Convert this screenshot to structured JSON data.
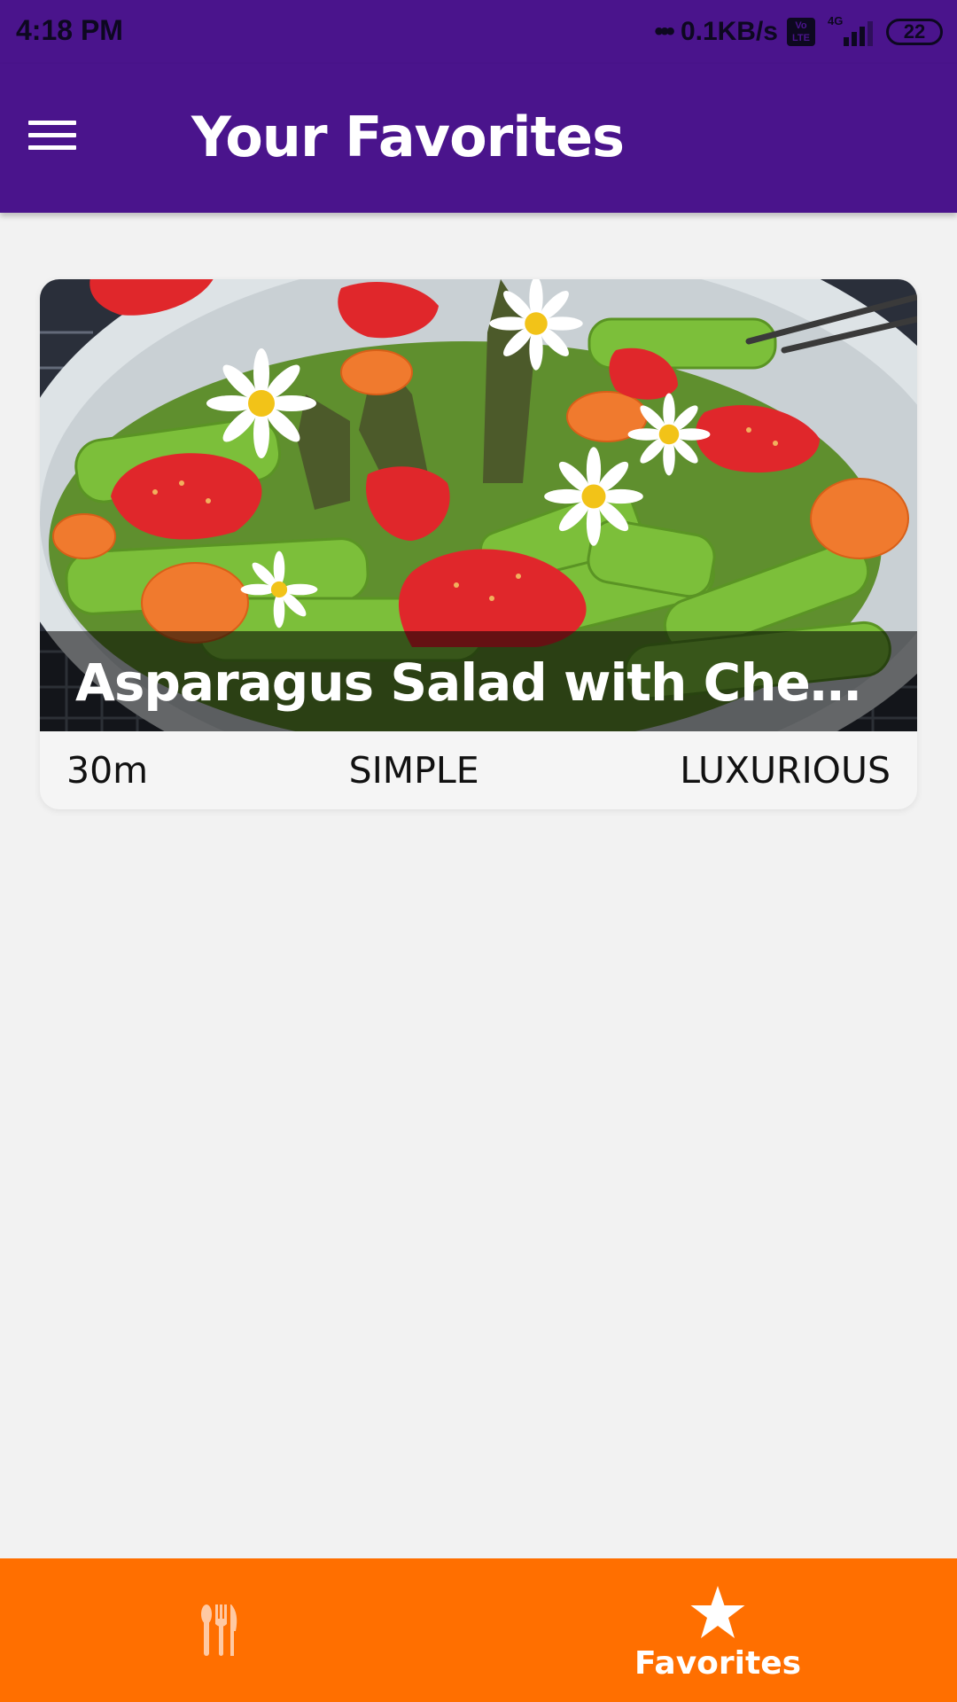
{
  "status_bar": {
    "time": "4:18 PM",
    "net_speed": "0.1KB/s",
    "volte": "Vo LTE",
    "network": "4G",
    "battery": "22"
  },
  "app_bar": {
    "title": "Your Favorites",
    "menu_icon": "hamburger-menu-icon"
  },
  "meal": {
    "title": "Asparagus Salad with Cherry Tomatoes",
    "duration": "30m",
    "complexity": "SIMPLE",
    "affordability": "LUXURIOUS"
  },
  "bottom_nav": {
    "tabs": [
      {
        "icon": "fork-knife-icon",
        "label": "",
        "active": false
      },
      {
        "icon": "star-icon",
        "label": "Favorites",
        "active": true
      }
    ]
  },
  "colors": {
    "primary": "#4a148c",
    "accent": "#ff6f00",
    "background": "#f2f2f2"
  }
}
